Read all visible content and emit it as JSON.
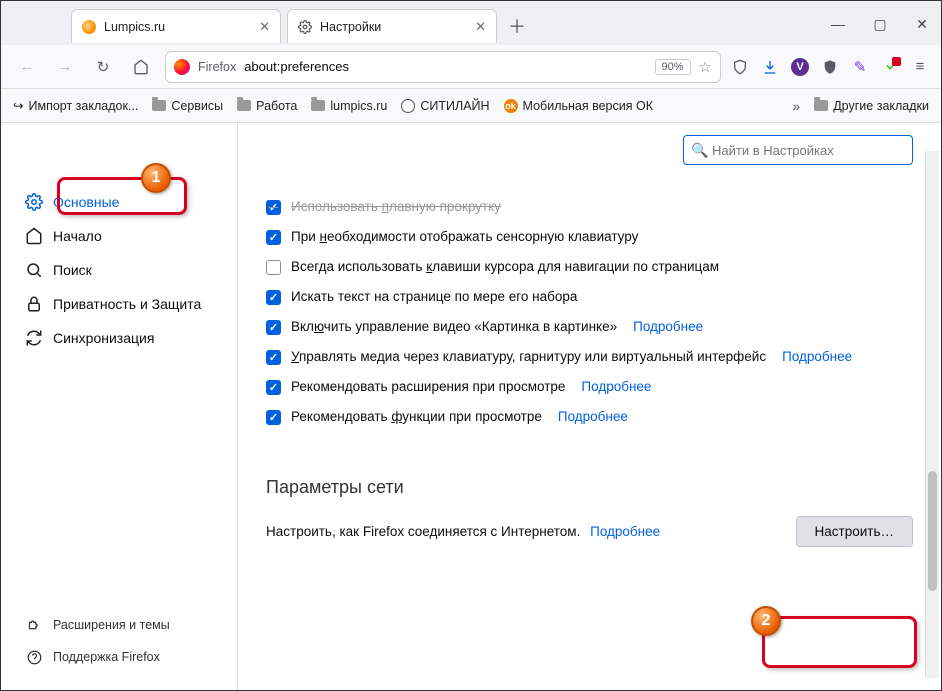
{
  "tabs": [
    {
      "title": "Lumpics.ru",
      "favicon_color": "#ff9400"
    },
    {
      "title": "Настройки",
      "is_settings": true
    }
  ],
  "winctrl": {
    "min": "—",
    "max": "▢",
    "close": "✕"
  },
  "nav": {
    "reload": "↻"
  },
  "urlbar": {
    "identity": "Firefox",
    "url": "about:preferences",
    "zoom": "90%"
  },
  "toolbar_icons": {
    "shield": "⛉",
    "download": "⬇",
    "v": "V",
    "ext_shield": "⛨",
    "feather": "✎",
    "arrow": "⬇",
    "menu": "≡"
  },
  "bookmarks": {
    "items": [
      {
        "label": "Импорт закладок...",
        "kind": "import"
      },
      {
        "label": "Сервисы",
        "kind": "folder"
      },
      {
        "label": "Работа",
        "kind": "folder"
      },
      {
        "label": "lumpics.ru",
        "kind": "folder"
      },
      {
        "label": "СИТИЛАЙН",
        "kind": "globe"
      },
      {
        "label": "Мобильная версия ОК",
        "kind": "ok"
      }
    ],
    "chevron": "»",
    "other": "Другие закладки"
  },
  "sidebar": {
    "items": [
      {
        "label": "Основные",
        "icon": "gear",
        "active": true
      },
      {
        "label": "Начало",
        "icon": "home"
      },
      {
        "label": "Поиск",
        "icon": "search"
      },
      {
        "label": "Приватность и Защита",
        "icon": "lock"
      },
      {
        "label": "Синхронизация",
        "icon": "sync"
      }
    ],
    "bottom": [
      {
        "label": "Расширения и темы",
        "icon": "puzzle"
      },
      {
        "label": "Поддержка Firefox",
        "icon": "help"
      }
    ]
  },
  "search_placeholder": "Найти в Настройках",
  "checks": [
    {
      "checked": true,
      "label_pre": "Использовать ",
      "accel": "п",
      "label_post": "лавную прокрутку"
    },
    {
      "checked": true,
      "label_pre": "При ",
      "accel": "н",
      "label_post": "еобходимости отображать сенсорную клавиатуру"
    },
    {
      "checked": false,
      "label_pre": "Всегда использовать ",
      "accel": "к",
      "label_post": "лавиши курсора для навигации по страницам"
    },
    {
      "checked": true,
      "label_pre": "Искать текст на странице по мере его набора"
    },
    {
      "checked": true,
      "label_pre": "Вкл",
      "accel": "ю",
      "label_post": "чить управление видео «Картинка в картинке»",
      "link": "Подробнее"
    },
    {
      "checked": true,
      "label_pre": "",
      "accel": "У",
      "label_post": "правлять медиа через клавиатуру, гарнитуру или виртуальный интерфейс",
      "link": "Подробнее"
    },
    {
      "checked": true,
      "label_pre": "Рекомендовать расширения при просмотре",
      "link": "Подробнее"
    },
    {
      "checked": true,
      "label_pre": "Рекомендовать ",
      "accel": "ф",
      "label_post": "ункции при просмотре",
      "link": "Подробнее"
    }
  ],
  "network": {
    "header": "Параметры сети",
    "desc": "Настроить, как Firefox соединяется с Интернетом.",
    "link": "Подробнее",
    "button": "Настроить…"
  },
  "annotations": {
    "one": "1",
    "two": "2"
  }
}
